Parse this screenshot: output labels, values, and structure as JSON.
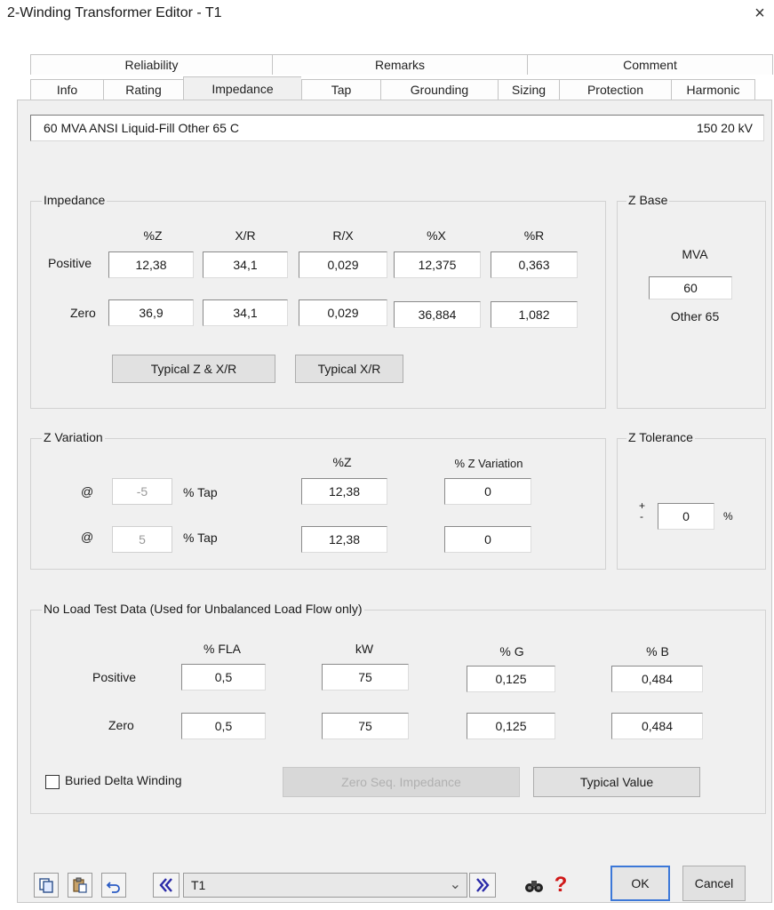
{
  "window": {
    "title": "2-Winding Transformer Editor - T1",
    "close": "×"
  },
  "tabs_top": [
    "Reliability",
    "Remarks",
    "Comment"
  ],
  "tabs_bottom": [
    "Info",
    "Rating",
    "Impedance",
    "Tap",
    "Grounding",
    "Sizing",
    "Protection",
    "Harmonic"
  ],
  "active_tab": "Impedance",
  "header": {
    "left": "60 MVA  ANSI  Liquid-Fill  Other  65 C",
    "right": "150   20 kV"
  },
  "impedance": {
    "title": "Impedance",
    "cols": [
      "%Z",
      "X/R",
      "R/X",
      "%X",
      "%R"
    ],
    "positive": {
      "label": "Positive",
      "values": [
        "12,38",
        "34,1",
        "0,029",
        "12,375",
        "0,363"
      ]
    },
    "zero": {
      "label": "Zero",
      "values": [
        "36,9",
        "34,1",
        "0,029",
        "36,884",
        "1,082"
      ]
    },
    "btn_typical_zxr": "Typical Z & X/R",
    "btn_typical_xr": "Typical  X/R"
  },
  "zbase": {
    "title": "Z Base",
    "mva_label": "MVA",
    "mva_value": "60",
    "type": "Other 65"
  },
  "zvariation": {
    "title": "Z Variation",
    "col_z": "%Z",
    "col_var": "% Z Variation",
    "rows": [
      {
        "at": "@",
        "tap": "-5",
        "tap_label": "% Tap",
        "z": "12,38",
        "variation": "0"
      },
      {
        "at": "@",
        "tap": "5",
        "tap_label": "% Tap",
        "z": "12,38",
        "variation": "0"
      }
    ]
  },
  "ztolerance": {
    "title": "Z Tolerance",
    "plus": "+",
    "minus": "-",
    "value": "0",
    "unit": "%"
  },
  "noload": {
    "title": "No Load Test Data (Used for Unbalanced Load Flow only)",
    "cols": [
      "% FLA",
      "kW",
      "% G",
      "% B"
    ],
    "positive": {
      "label": "Positive",
      "values": [
        "0,5",
        "75",
        "0,125",
        "0,484"
      ]
    },
    "zero": {
      "label": "Zero",
      "values": [
        "0,5",
        "75",
        "0,125",
        "0,484"
      ]
    },
    "buried_delta": "Buried Delta Winding",
    "btn_zero_seq": "Zero Seq. Impedance",
    "btn_typical_value": "Typical Value"
  },
  "footer": {
    "element": "T1",
    "dropdown_arrow": "⌄",
    "ok": "OK",
    "cancel": "Cancel",
    "help": "?"
  }
}
